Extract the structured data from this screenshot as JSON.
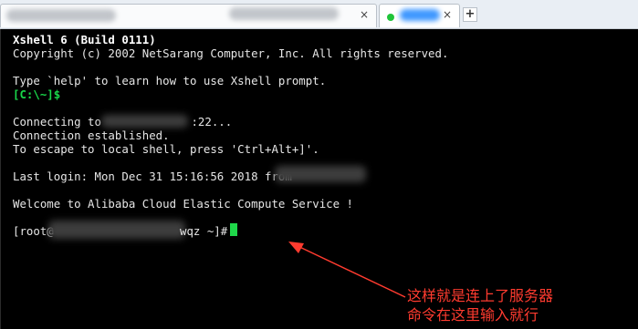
{
  "tabs": {
    "add_label": "+",
    "close_label": "×"
  },
  "terminal": {
    "banner_title": "Xshell 6 (Build 0111)",
    "copyright": "Copyright (c) 2002 NetSarang Computer, Inc. All rights reserved.",
    "help_line": "Type `help' to learn how to use Xshell prompt.",
    "local_prompt": "[C:\\~]$",
    "connecting_prefix": "Connecting to ",
    "connecting_suffix": ":22...",
    "established": "Connection established.",
    "escape_line": "To escape to local shell, press 'Ctrl+Alt+]'.",
    "last_login": "Last login: Mon Dec 31 15:16:56 2018 from",
    "welcome": "Welcome to Alibaba Cloud Elastic Compute Service !",
    "remote_prompt_prefix": "[root@",
    "remote_prompt_suffix": "wqz ~]#"
  },
  "annotation": {
    "line1": "这样就是连上了服务器",
    "line2": "命令在这里输入就行",
    "color": "#ff3b2f"
  },
  "colors": {
    "prompt_green": "#19d84a",
    "cursor_green": "#1fd84a",
    "background": "#000000"
  }
}
